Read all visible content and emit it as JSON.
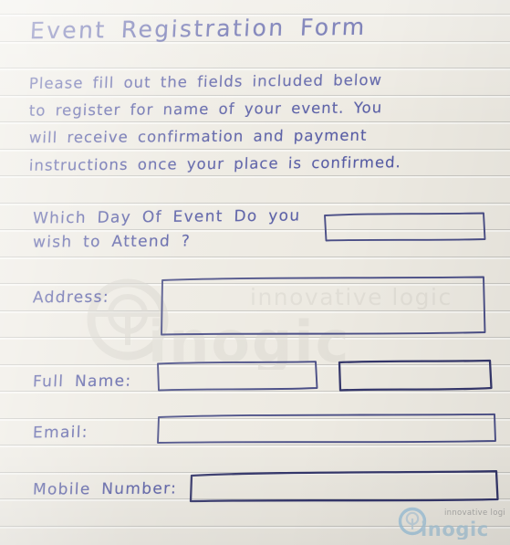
{
  "document": {
    "title": "Event Registration Form",
    "medium": "handwritten on ruled notepaper",
    "ink_color": "#575ca4",
    "paper_color": "#edeae2",
    "rule_color": "#969696",
    "box_stroke_color": "#4a4e86"
  },
  "intro": {
    "lines": [
      "Please fill out the fields included below",
      "to register for name of your event. You",
      "will receive confirmation and payment",
      "instructions once your place is confirmed."
    ]
  },
  "fields": {
    "day_of_event": {
      "label_line_1": "Which Day Of Event Do you",
      "label_line_2": "wish to Attend ?",
      "value": "",
      "placeholder": ""
    },
    "address": {
      "label": "Address:",
      "value": "",
      "placeholder": ""
    },
    "full_name": {
      "label": "Full Name:",
      "first_value": "",
      "last_value": "",
      "placeholder": ""
    },
    "email": {
      "label": "Email:",
      "value": "",
      "placeholder": ""
    },
    "mobile_number": {
      "label": "Mobile Number:",
      "value": "",
      "placeholder": ""
    }
  },
  "watermark": {
    "wordmark": "inogic",
    "tagline": "innovative logic",
    "center_color": "#d9d6cf",
    "corner_wordmark_color": "#8fb6cf",
    "corner_tagline_color": "#9a9a9a"
  }
}
